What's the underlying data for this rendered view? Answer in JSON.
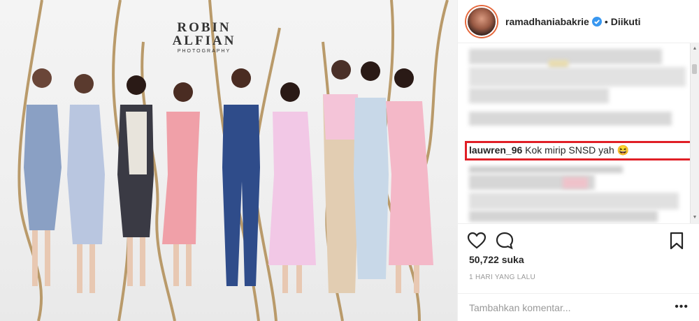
{
  "photo": {
    "watermark": {
      "line1": "ROBIN",
      "line2": "ALFIAN",
      "line3": "PHOTOGRAPHY"
    }
  },
  "header": {
    "username": "ramadhaniabakrie",
    "separator": "•",
    "follow_status": "Diikuti"
  },
  "comments": {
    "highlighted": {
      "username": "lauwren_96",
      "text": "Kok mirip SNSD yah",
      "emoji": "😆"
    }
  },
  "stats": {
    "likes": "50,722 suka",
    "timestamp": "1 HARI YANG LALU"
  },
  "add_comment": {
    "placeholder": "Tambahkan komentar...",
    "more": "•••"
  },
  "colors": {
    "highlight_border": "#e01f26",
    "verified_blue": "#3897f0"
  },
  "icons": [
    "heart-icon",
    "comment-icon",
    "bookmark-icon",
    "verified-icon",
    "more-icon"
  ]
}
